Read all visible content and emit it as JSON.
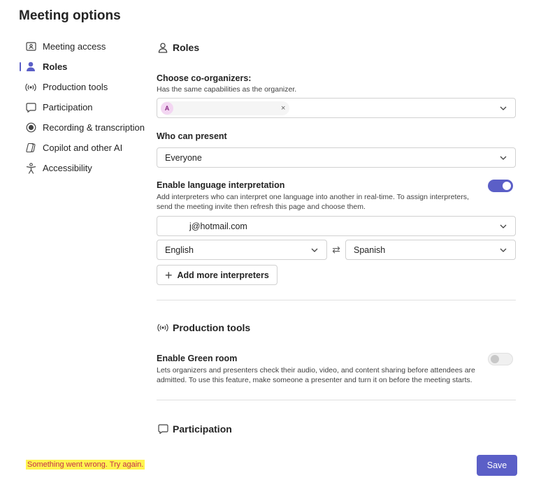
{
  "page": {
    "title": "Meeting options"
  },
  "sidebar": {
    "items": [
      {
        "label": "Meeting access",
        "icon": "id-card-icon"
      },
      {
        "label": "Roles",
        "icon": "person-icon",
        "active": true
      },
      {
        "label": "Production tools",
        "icon": "broadcast-icon"
      },
      {
        "label": "Participation",
        "icon": "chat-icon"
      },
      {
        "label": "Recording & transcription",
        "icon": "record-icon"
      },
      {
        "label": "Copilot and other AI",
        "icon": "copilot-icon"
      },
      {
        "label": "Accessibility",
        "icon": "accessibility-icon"
      }
    ]
  },
  "roles": {
    "heading": "Roles",
    "coorganizers": {
      "label": "Choose co-organizers:",
      "help": "Has the same capabilities as the organizer.",
      "chip_initial": "A",
      "chip_remove": "×"
    },
    "presenters": {
      "label": "Who can present",
      "value": "Everyone"
    },
    "interpretation": {
      "label": "Enable language interpretation",
      "help": "Add interpreters who can interpret one language into another in real-time. To assign interpreters, send the meeting invite then refresh this page and choose them.",
      "enabled": true,
      "interpreter": "j@hotmail.com",
      "source_language": "English",
      "swap_symbol": "⇄",
      "target_language": "Spanish",
      "add_button": "Add more interpreters"
    }
  },
  "production": {
    "heading": "Production tools",
    "green_room": {
      "label": "Enable Green room",
      "help": "Lets organizers and presenters check their audio, video, and content sharing before attendees are admitted. To use this feature, make someone a presenter and turn it on before the meeting starts.",
      "enabled": false
    }
  },
  "participation": {
    "heading": "Participation"
  },
  "footer": {
    "error": "Something went wrong. Try again.",
    "save": "Save"
  },
  "colors": {
    "accent": "#5b5fc7",
    "error": "#c4314b",
    "highlight": "#fff44f"
  }
}
